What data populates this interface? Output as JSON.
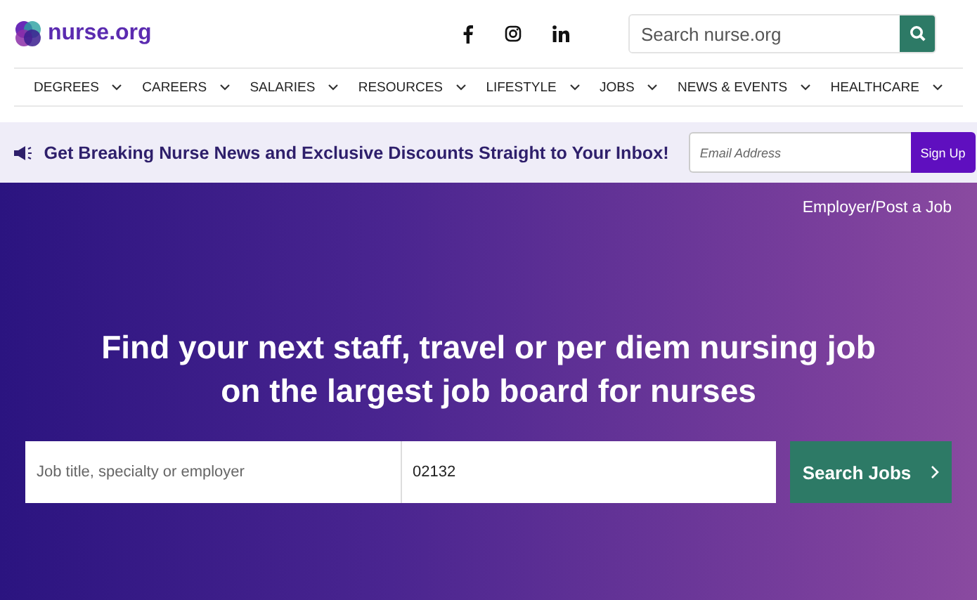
{
  "header": {
    "logo": "nurse.org",
    "search": {
      "placeholder": "Search nurse.org"
    }
  },
  "nav": [
    {
      "label": "DEGREES"
    },
    {
      "label": "CAREERS"
    },
    {
      "label": "SALARIES"
    },
    {
      "label": "RESOURCES"
    },
    {
      "label": "LIFESTYLE"
    },
    {
      "label": "JOBS"
    },
    {
      "label": "NEWS & EVENTS"
    },
    {
      "label": "HEALTHCARE"
    }
  ],
  "banner": {
    "text": "Get Breaking Nurse News and Exclusive Discounts Straight to Your Inbox!",
    "email": {
      "placeholder": "Email Address"
    },
    "button": "Sign Up"
  },
  "hero": {
    "employer_link": "Employer/Post a Job",
    "headline": "Find your next staff, travel or per diem nursing job on the largest job board for nurses",
    "job_field": {
      "placeholder": "Job title, specialty or employer"
    },
    "location_field": {
      "value": "02132"
    },
    "button": "Search Jobs"
  }
}
